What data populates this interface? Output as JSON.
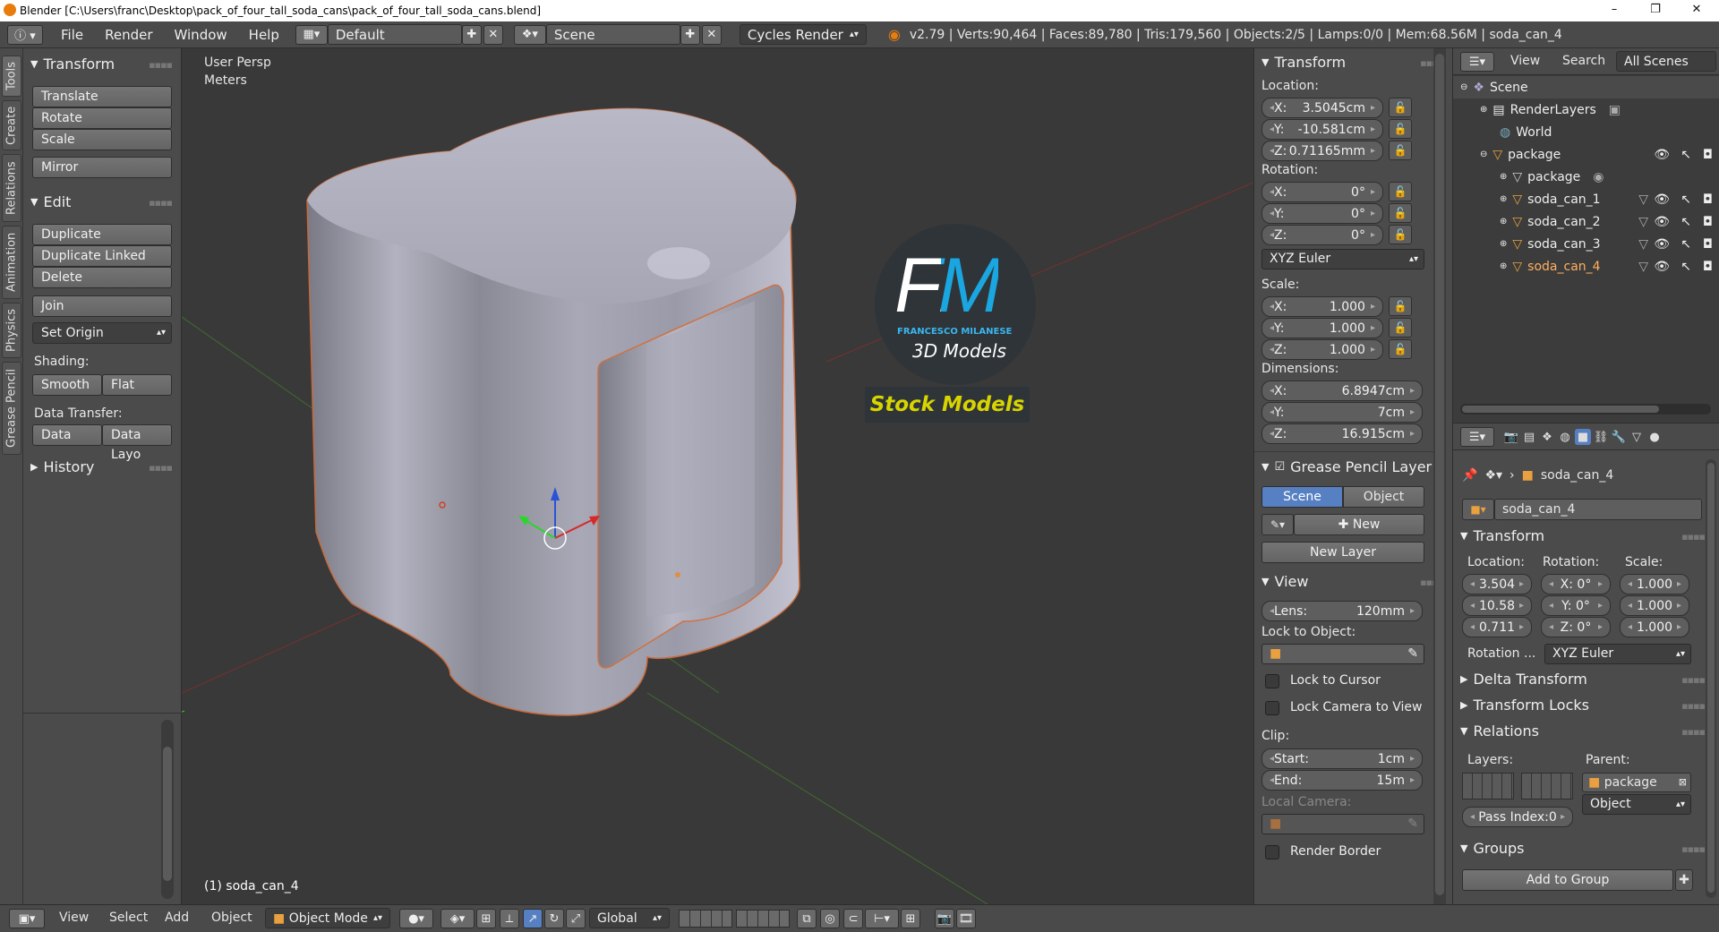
{
  "window": {
    "title": "Blender [C:\\Users\\franc\\Desktop\\pack_of_four_tall_soda_cans\\pack_of_four_tall_soda_cans.blend]",
    "minimize": "–",
    "maximize": "❐",
    "close": "✕"
  },
  "infobar": {
    "menus": [
      "File",
      "Render",
      "Window",
      "Help"
    ],
    "layout": "Default",
    "scene": "Scene",
    "engine": "Cycles Render",
    "stats": "v2.79 | Verts:90,464 | Faces:89,780 | Tris:179,560 | Objects:2/5 | Lamps:0/0 | Mem:68.56M | soda_can_4"
  },
  "tabs": [
    "Tools",
    "Create",
    "Relations",
    "Animation",
    "Physics",
    "Grease Pencil"
  ],
  "toolshelf": {
    "transform_title": "Transform",
    "transform_buttons": [
      "Translate",
      "Rotate",
      "Scale"
    ],
    "mirror": "Mirror",
    "edit_title": "Edit",
    "edit_buttons": [
      "Duplicate",
      "Duplicate Linked",
      "Delete"
    ],
    "join": "Join",
    "set_origin": "Set Origin",
    "shading_label": "Shading:",
    "smooth": "Smooth",
    "flat": "Flat",
    "data_transfer_label": "Data Transfer:",
    "data": "Data",
    "data_layout": "Data Layo",
    "history": "History"
  },
  "viewport": {
    "view_label": "User Persp",
    "units_label": "Meters",
    "object_label": "(1) soda_can_4",
    "watermark_fm": "FM",
    "watermark_name": "FRANCESCO MILANESE",
    "watermark_3d": "3D Models",
    "watermark_stock": "Stock Models"
  },
  "npanel": {
    "transform_title": "Transform",
    "location_label": "Location:",
    "location": [
      {
        "axis": "X:",
        "value": "3.5045cm"
      },
      {
        "axis": "Y:",
        "value": "-10.581cm"
      },
      {
        "axis": "Z:",
        "value": "0.71165mm"
      }
    ],
    "rotation_label": "Rotation:",
    "rotation": [
      {
        "axis": "X:",
        "value": "0°"
      },
      {
        "axis": "Y:",
        "value": "0°"
      },
      {
        "axis": "Z:",
        "value": "0°"
      }
    ],
    "rotation_mode": "XYZ Euler",
    "scale_label": "Scale:",
    "scale": [
      {
        "axis": "X:",
        "value": "1.000"
      },
      {
        "axis": "Y:",
        "value": "1.000"
      },
      {
        "axis": "Z:",
        "value": "1.000"
      }
    ],
    "dimensions_label": "Dimensions:",
    "dimensions": [
      {
        "axis": "X:",
        "value": "6.8947cm"
      },
      {
        "axis": "Y:",
        "value": "7cm"
      },
      {
        "axis": "Z:",
        "value": "16.915cm"
      }
    ],
    "grease_title": "Grease Pencil Layer",
    "scene_tab": "Scene",
    "object_tab": "Object",
    "new_btn": "New",
    "new_layer": "New Layer",
    "view_title": "View",
    "lens_label": "Lens:",
    "lens_value": "120mm",
    "lock_object_label": "Lock to Object:",
    "lock_cursor": "Lock to Cursor",
    "lock_camera": "Lock Camera to View",
    "clip_label": "Clip:",
    "clip_start_label": "Start:",
    "clip_start": "1cm",
    "clip_end_label": "End:",
    "clip_end": "15m",
    "local_camera_label": "Local Camera:",
    "render_border": "Render Border"
  },
  "outliner": {
    "view": "View",
    "search": "Search",
    "all_scenes": "All Scenes",
    "items": [
      "Scene",
      "RenderLayers",
      "World",
      "package",
      "package",
      "soda_can_1",
      "soda_can_2",
      "soda_can_3",
      "soda_can_4"
    ]
  },
  "properties": {
    "object_path": "soda_can_4",
    "object_name": "soda_can_4",
    "transform_title": "Transform",
    "location_label": "Location:",
    "rotation_label": "Rotation:",
    "scale_label": "Scale:",
    "location": [
      "3.504",
      "10.58",
      "0.711"
    ],
    "rotation": [
      "X:  0°",
      "Y:  0°",
      "Z:  0°"
    ],
    "scale": [
      "1.000",
      "1.000",
      "1.000"
    ],
    "rotation_mode_label": "Rotation ...",
    "rotation_mode": "XYZ Euler",
    "delta_transform": "Delta Transform",
    "transform_locks": "Transform Locks",
    "relations": "Relations",
    "layers_label": "Layers:",
    "parent_label": "Parent:",
    "parent": "package",
    "parent_type": "Object",
    "pass_index": "Pass Index:0",
    "groups": "Groups",
    "add_to_group": "Add to Group"
  },
  "bottombar": {
    "menus": [
      "View",
      "Select",
      "Add",
      "Object"
    ],
    "mode": "Object Mode",
    "orientation": "Global"
  }
}
